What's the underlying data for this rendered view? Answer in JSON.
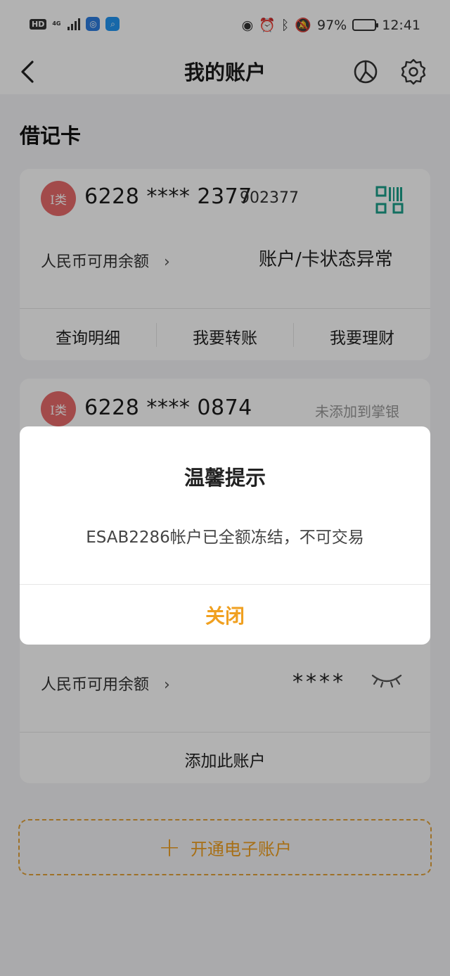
{
  "status_bar": {
    "hd": "HD",
    "network": "4G",
    "battery": "97%",
    "time": "12:41"
  },
  "header": {
    "title": "我的账户"
  },
  "section": {
    "title": "借记卡"
  },
  "cards": [
    {
      "badge": "I类",
      "card_number": "6228 **** 2377",
      "suffix": "902377",
      "balance_label": "人民币可用余额",
      "balance_chevron": "›",
      "status": "账户/卡状态异常",
      "actions": [
        "查询明细",
        "我要转账",
        "我要理财"
      ]
    },
    {
      "badge": "I类",
      "card_number": "6228 **** 0874",
      "not_added": "未添加到掌银",
      "balance_label": "人民币可用余额",
      "balance_chevron": "›",
      "balance_masked": "****",
      "add_account": "添加此账户"
    }
  ],
  "open_account": {
    "plus": "+",
    "label": "开通电子账户"
  },
  "dialog": {
    "title": "温馨提示",
    "message": "ESAB2286帐户已全额冻结，不可交易",
    "close_label": "关闭"
  },
  "colors": {
    "accent": "#f0a020",
    "badge": "#e86b6b",
    "qr": "#1aa08a",
    "overlay": "rgba(0,0,0,0.30)"
  }
}
